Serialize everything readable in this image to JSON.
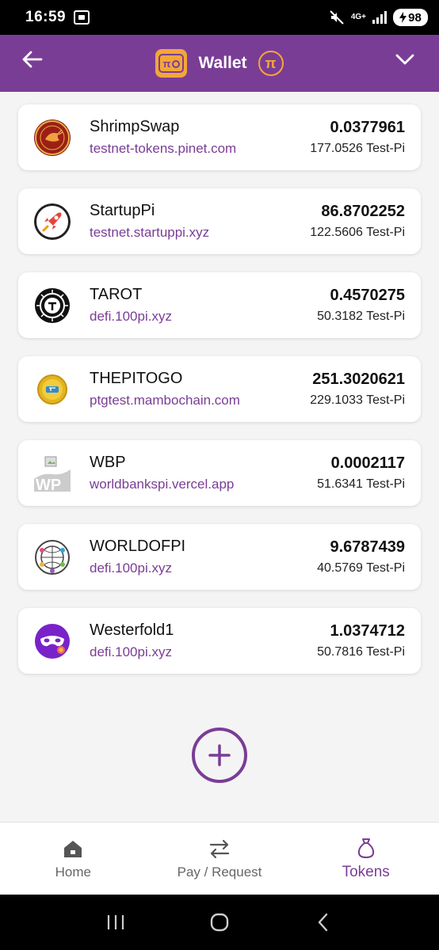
{
  "status_bar": {
    "time": "16:59",
    "network": "4G+",
    "battery": "98"
  },
  "header": {
    "title": "Wallet",
    "pi_symbol": "π",
    "wallet_symbol": "π"
  },
  "tokens": [
    {
      "name": "ShrimpSwap",
      "domain": "testnet-tokens.pinet.com",
      "amount": "0.0377961",
      "pi_value": "177.0526 Test-Pi",
      "logo": "shrimp-logo"
    },
    {
      "name": "StartupPi",
      "domain": "testnet.startuppi.xyz",
      "amount": "86.8702252",
      "pi_value": "122.5606 Test-Pi",
      "logo": "rocket-logo"
    },
    {
      "name": "TAROT",
      "domain": "defi.100pi.xyz",
      "amount": "0.4570275",
      "pi_value": "50.3182 Test-Pi",
      "logo": "tarot-logo"
    },
    {
      "name": "THEPITOGO",
      "domain": "ptgtest.mambochain.com",
      "amount": "251.3020621",
      "pi_value": "229.1033 Test-Pi",
      "logo": "coin-logo"
    },
    {
      "name": "WBP",
      "domain": "worldbankspi.vercel.app",
      "amount": "0.0002117",
      "pi_value": "51.6341 Test-Pi",
      "logo": "broken-image-logo"
    },
    {
      "name": "WORLDOFPI",
      "domain": "defi.100pi.xyz",
      "amount": "9.6787439",
      "pi_value": "40.5769 Test-Pi",
      "logo": "globe-people-logo"
    },
    {
      "name": "Westerfold1",
      "domain": "defi.100pi.xyz",
      "amount": "1.0374712",
      "pi_value": "50.7816 Test-Pi",
      "logo": "mask-logo"
    }
  ],
  "bottom_nav": {
    "items": [
      {
        "label": "Home",
        "icon": "home-icon"
      },
      {
        "label": "Pay / Request",
        "icon": "swap-arrows-icon"
      },
      {
        "label": "Tokens",
        "icon": "money-bag-icon"
      }
    ],
    "active": "Tokens"
  },
  "colors": {
    "primary": "#7a3d96",
    "accent": "#f3a638"
  }
}
